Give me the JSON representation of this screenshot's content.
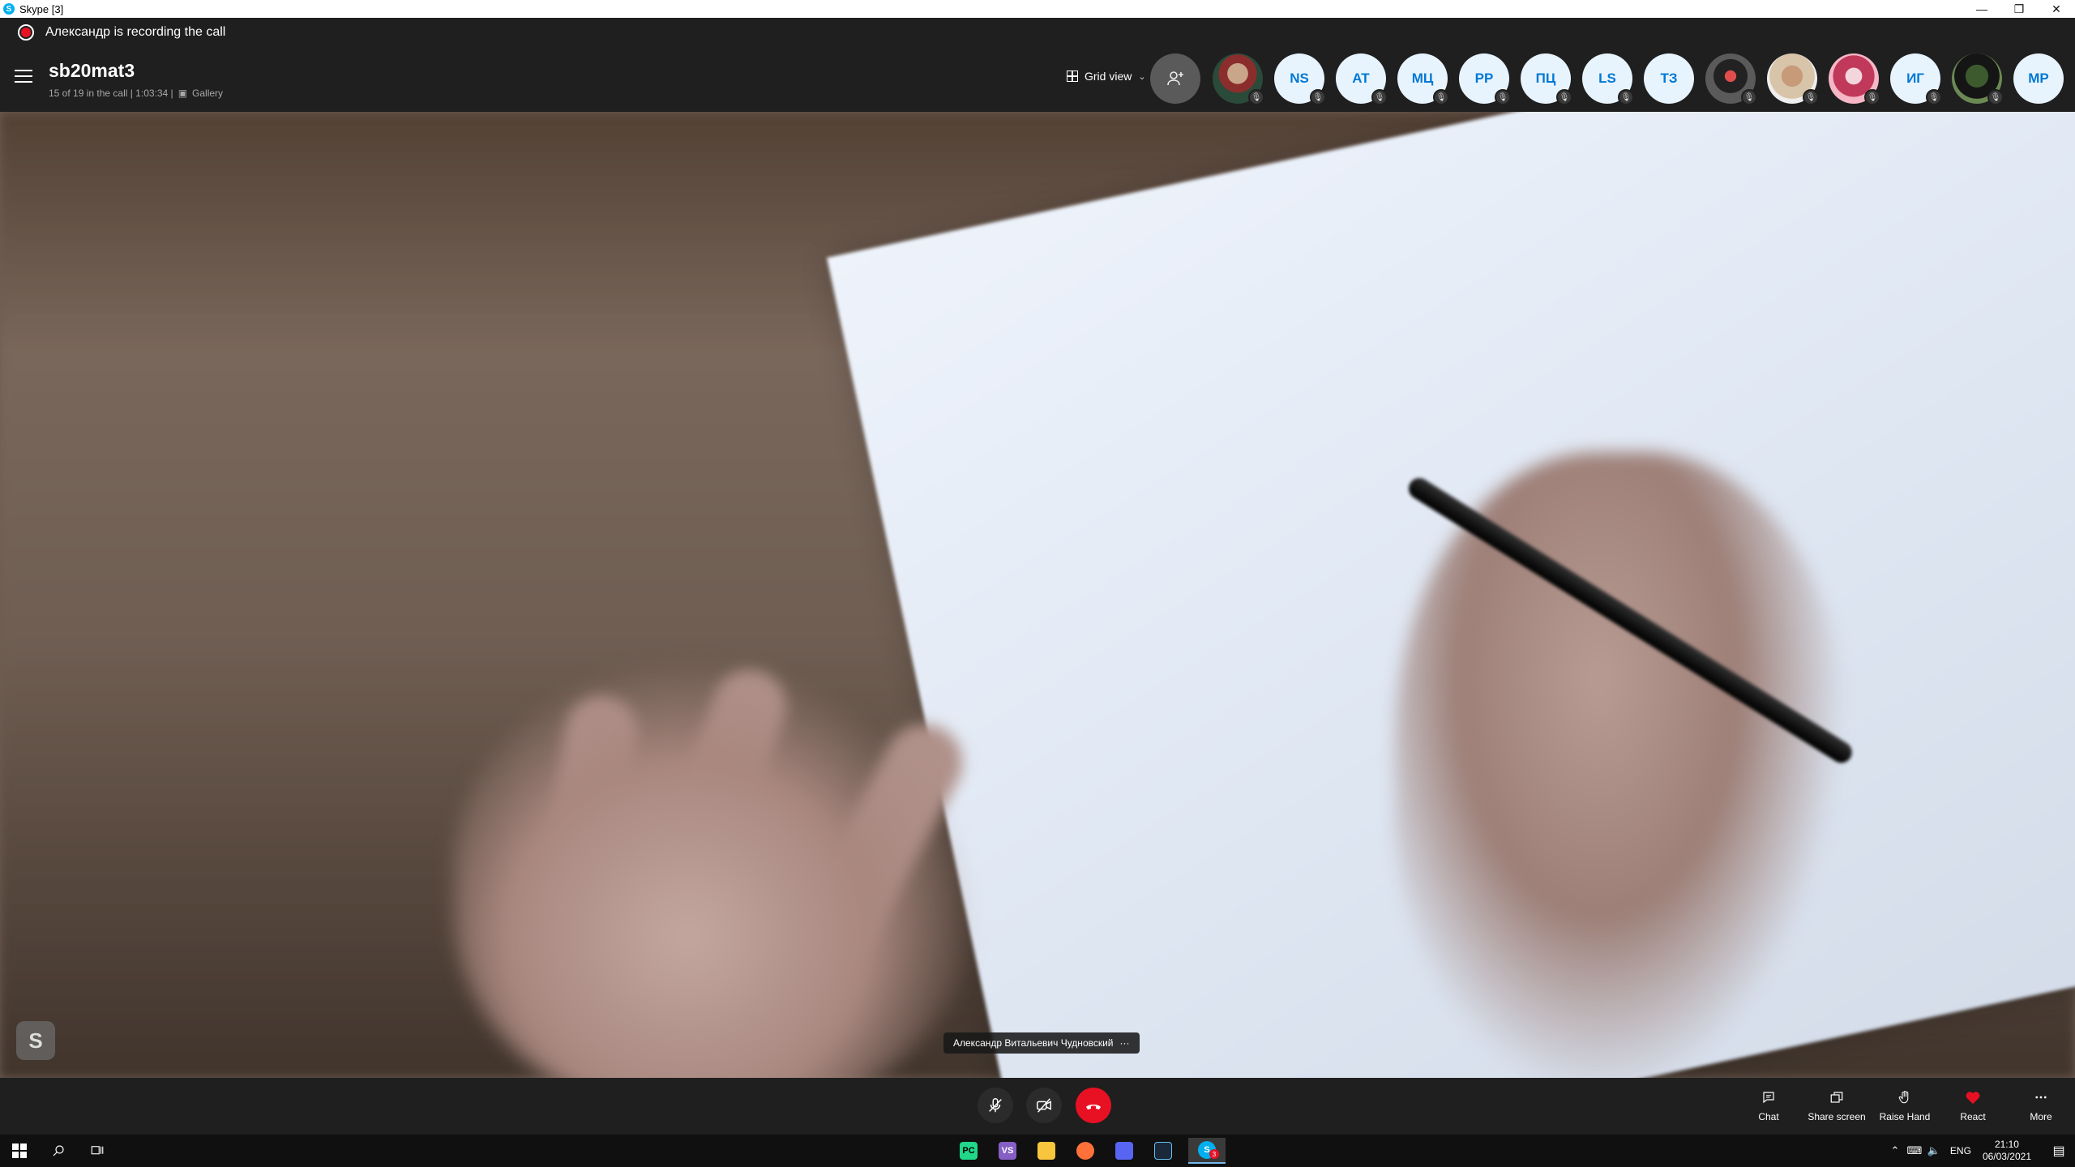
{
  "window": {
    "title": "Skype [3]",
    "app_icon_letter": "S",
    "minimize_glyph": "—",
    "restore_glyph": "❐",
    "close_glyph": "✕"
  },
  "recording": {
    "text": "Александр is recording the call",
    "dot_color": "#e81123"
  },
  "call": {
    "title": "sb20mat3",
    "status": "15 of 19 in the call | 1:03:34 |",
    "view_label": "Gallery",
    "grid_view_label": "Grid view",
    "add_people_icon": "add-person-icon"
  },
  "participants": [
    {
      "type": "photo",
      "initials": ""
    },
    {
      "type": "initials",
      "initials": "NS"
    },
    {
      "type": "initials",
      "initials": "AT"
    },
    {
      "type": "initials",
      "initials": "МЦ"
    },
    {
      "type": "initials",
      "initials": "PP"
    },
    {
      "type": "initials",
      "initials": "ПЦ"
    },
    {
      "type": "initials",
      "initials": "LS"
    },
    {
      "type": "initials",
      "initials": "ТЗ"
    },
    {
      "type": "photo",
      "initials": ""
    },
    {
      "type": "photo",
      "initials": ""
    },
    {
      "type": "photo",
      "initials": ""
    },
    {
      "type": "initials",
      "initials": "ИГ"
    },
    {
      "type": "photo",
      "initials": ""
    },
    {
      "type": "initials",
      "initials": "MP"
    }
  ],
  "video": {
    "speaker_name": "Александр Витальевич Чудновский",
    "more_glyph": "···",
    "badge_letter": "S"
  },
  "controls": {
    "mute_icon": "microphone-off-icon",
    "camera_icon": "camera-off-icon",
    "end_call_icon": "hang-up-icon",
    "end_call_color": "#e81123",
    "tools": [
      {
        "label": "Chat",
        "icon": "chat-icon"
      },
      {
        "label": "Share screen",
        "icon": "share-screen-icon"
      },
      {
        "label": "Raise Hand",
        "icon": "raise-hand-icon"
      },
      {
        "label": "React",
        "icon": "heart-icon"
      },
      {
        "label": "More",
        "icon": "more-icon"
      }
    ]
  },
  "taskbar": {
    "lang": "ENG",
    "time": "21:10",
    "date": "06/03/2021",
    "skype_badge": "3",
    "apps": [
      "pycharm-icon",
      "visual-studio-icon",
      "file-explorer-icon",
      "firefox-icon",
      "discord-icon",
      "steam-icon",
      "skype-icon"
    ]
  }
}
